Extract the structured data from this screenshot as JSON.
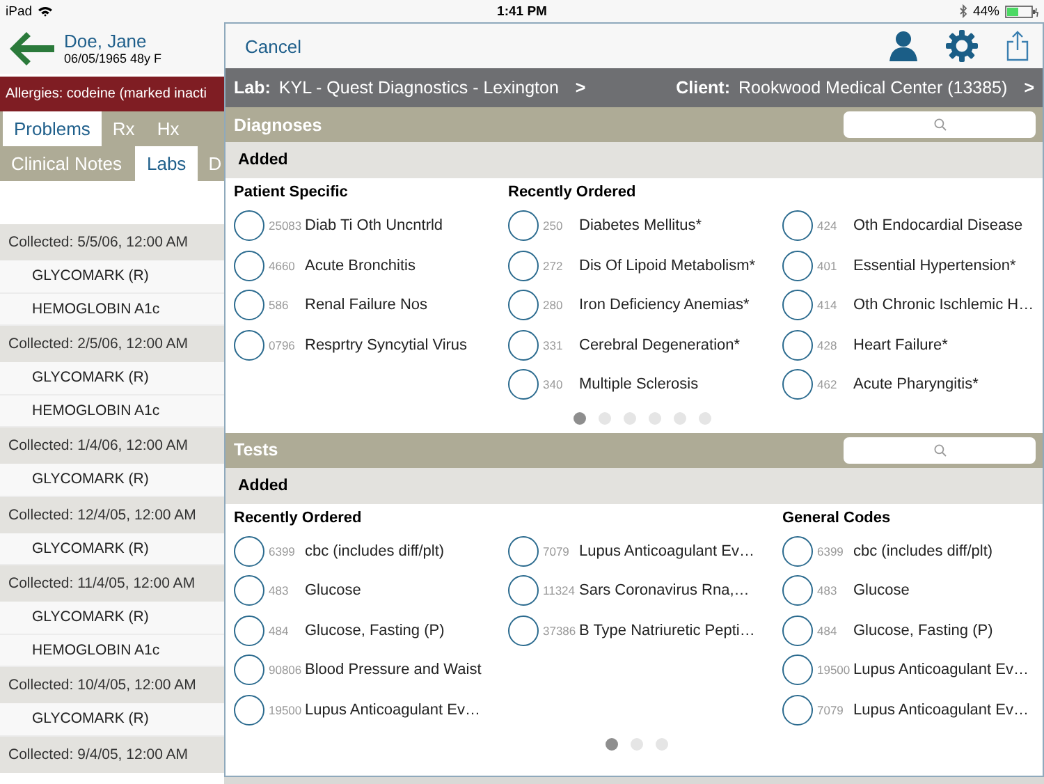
{
  "status_bar": {
    "device": "iPad",
    "time": "1:41 PM",
    "battery": "44%"
  },
  "patient": {
    "name": "Doe, Jane",
    "details": "06/05/1965  48y  F"
  },
  "allergies": "Allergies:  codeine (marked inacti",
  "tabs_row1": [
    {
      "label": "Problems",
      "selected": true
    },
    {
      "label": "Rx",
      "selected": false
    },
    {
      "label": "Hx",
      "selected": false
    }
  ],
  "tabs_row2": [
    {
      "label": "Clinical Notes",
      "selected": false
    },
    {
      "label": "Labs",
      "selected": true
    },
    {
      "label": "D",
      "selected": false
    }
  ],
  "lab_groups": [
    {
      "collected": "Collected: 5/5/06, 12:00 AM",
      "items": [
        "GLYCOMARK (R)",
        "HEMOGLOBIN A1c"
      ]
    },
    {
      "collected": "Collected: 2/5/06, 12:00 AM",
      "items": [
        "GLYCOMARK (R)",
        "HEMOGLOBIN A1c"
      ]
    },
    {
      "collected": "Collected: 1/4/06, 12:00 AM",
      "items": [
        "GLYCOMARK (R)"
      ]
    },
    {
      "collected": "Collected: 12/4/05, 12:00 AM",
      "items": [
        "GLYCOMARK (R)"
      ]
    },
    {
      "collected": "Collected: 11/4/05, 12:00 AM",
      "items": [
        "GLYCOMARK (R)",
        "HEMOGLOBIN A1c"
      ]
    },
    {
      "collected": "Collected: 10/4/05, 12:00 AM",
      "items": [
        "GLYCOMARK (R)"
      ]
    },
    {
      "collected": "Collected: 9/4/05, 12:00 AM"
    }
  ],
  "modal": {
    "cancel": "Cancel",
    "lab_label": "Lab:",
    "lab_value": "KYL - Quest Diagnostics - Lexington",
    "lab_chevron": ">",
    "client_label": "Client:",
    "client_value": "Rookwood Medical Center (13385)",
    "client_chevron": ">",
    "sections": [
      {
        "title": "Diagnoses",
        "added": "Added",
        "columns": [
          {
            "heading": "Patient Specific",
            "items": [
              {
                "code": "25083",
                "name": "Diab Ti Oth Uncntrld",
                "selected": false
              },
              {
                "code": "4660",
                "name": "Acute Bronchitis",
                "selected": false
              },
              {
                "code": "586",
                "name": "Renal Failure Nos",
                "selected": false
              },
              {
                "code": "0796",
                "name": "Resprtry Syncytial Virus",
                "selected": false
              }
            ]
          },
          {
            "heading": "Recently Ordered",
            "items": [
              {
                "code": "250",
                "name": "Diabetes Mellitus*",
                "selected": false
              },
              {
                "code": "272",
                "name": "Dis Of Lipoid Metabolism*",
                "selected": false
              },
              {
                "code": "280",
                "name": "Iron Deficiency Anemias*",
                "selected": false
              },
              {
                "code": "331",
                "name": "Cerebral Degeneration*",
                "selected": false
              },
              {
                "code": "340",
                "name": "Multiple Sclerosis",
                "selected": false
              }
            ]
          },
          {
            "items": [
              {
                "code": "424",
                "name": "Oth Endocardial Disease",
                "selected": false
              },
              {
                "code": "401",
                "name": "Essential Hypertension*",
                "selected": false
              },
              {
                "code": "414",
                "name": "Oth Chronic Ischlemic H…",
                "selected": false
              },
              {
                "code": "428",
                "name": "Heart Failure*",
                "selected": false
              },
              {
                "code": "462",
                "name": "Acute Pharyngitis*",
                "selected": false
              }
            ]
          }
        ],
        "pages": [
          {
            "selected": true
          },
          {
            "selected": false
          },
          {
            "selected": false
          },
          {
            "selected": false
          },
          {
            "selected": false
          },
          {
            "selected": false
          }
        ]
      },
      {
        "title": "Tests",
        "added": "Added",
        "columns": [
          {
            "heading": "Recently Ordered",
            "items": [
              {
                "code": "6399",
                "name": "cbc (includes diff/plt)",
                "selected": false
              },
              {
                "code": "483",
                "name": "Glucose",
                "selected": false
              },
              {
                "code": "484",
                "name": "Glucose, Fasting (P)",
                "selected": false
              },
              {
                "code": "90806",
                "name": "Blood Pressure and Waist",
                "selected": false
              },
              {
                "code": "19500",
                "name": "Lupus Anticoagulant Ev…",
                "selected": false
              }
            ]
          },
          {
            "items": [
              {
                "code": "7079",
                "name": "Lupus Anticoagulant Ev…",
                "selected": false
              },
              {
                "code": "11324",
                "name": "Sars Coronavirus Rna,…",
                "selected": false
              },
              {
                "code": "37386",
                "name": "B Type Natriuretic Pepti…",
                "selected": false
              }
            ]
          },
          {
            "heading": "General Codes",
            "items": [
              {
                "code": "6399",
                "name": "cbc (includes diff/plt)",
                "selected": false
              },
              {
                "code": "483",
                "name": "Glucose",
                "selected": false
              },
              {
                "code": "484",
                "name": "Glucose, Fasting (P)",
                "selected": false
              },
              {
                "code": "19500",
                "name": "Lupus Anticoagulant Ev…",
                "selected": false
              },
              {
                "code": "7079",
                "name": "Lupus Anticoagulant Ev…",
                "selected": false
              }
            ]
          }
        ],
        "pages": [
          {
            "selected": true
          },
          {
            "selected": false
          },
          {
            "selected": false
          }
        ]
      }
    ]
  }
}
